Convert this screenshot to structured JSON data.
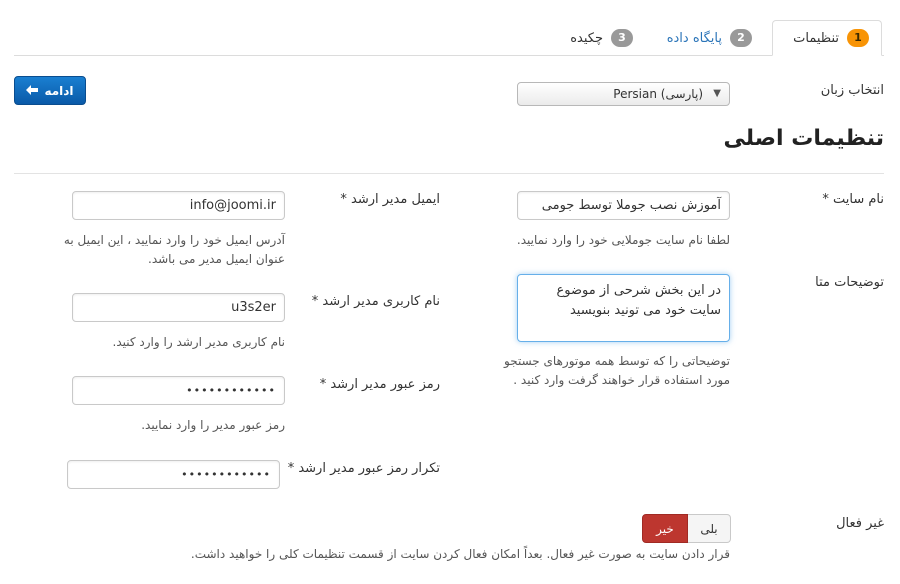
{
  "tabs": [
    {
      "badge": "1",
      "label": "تنظیمات"
    },
    {
      "badge": "2",
      "label": "پایگاه داده"
    },
    {
      "badge": "3",
      "label": "چکیده"
    }
  ],
  "next_button": {
    "label": "ادامه",
    "icon": "arrow-left-icon"
  },
  "language": {
    "label": "انتخاب زبان",
    "selected": "Persian (پارسی)"
  },
  "heading": "تنظیمات اصلی",
  "site_name": {
    "label": "نام سایت *",
    "value": "آموزش نصب جوملا توسط جومی",
    "help": "لطفا نام سایت جوملایی خود را وارد نمایید."
  },
  "meta_description": {
    "label": "توضیحات متا",
    "value_line1": "در این بخش شرحی از موضوع",
    "value_line2": "سایت خود می تونید بنویسید",
    "help_line1": "توضیحاتی را که توسط همه موتورهای جستجو",
    "help_line2": "مورد استفاده قرار خواهند گرفت وارد کنید ."
  },
  "admin_email": {
    "label": "ایمیل مدیر ارشد *",
    "value": "info@joomi.ir",
    "help_line1": "آدرس ایمیل خود را وارد نمایید ، این ایمیل به",
    "help_line2": "عنوان ایمیل مدیر می باشد."
  },
  "admin_username": {
    "label": "نام کاربری مدیر ارشد *",
    "value": "u3s2er",
    "help": "نام کاربری مدیر ارشد را وارد کنید."
  },
  "admin_password": {
    "label": "رمز عبور مدیر ارشد *",
    "value": "••••••••••••",
    "help": "رمز عبور مدیر را وارد نمایید."
  },
  "admin_password_confirm": {
    "label": "تکرار رمز عبور مدیر ارشد *",
    "value": "••••••••••••"
  },
  "offline": {
    "label": "غیر فعال",
    "no_label": "خیر",
    "yes_label": "بلی",
    "selected": "خیر",
    "help": "قرار دادن سایت به صورت غیر فعال. بعداً امکان فعال کردن سایت از قسمت تنظیمات کلی را خواهید داشت."
  },
  "colors": {
    "accent": "#0a5aa8",
    "badge_active": "#f89406",
    "toggle_active": "#bd362f",
    "link": "#2a74b8"
  }
}
